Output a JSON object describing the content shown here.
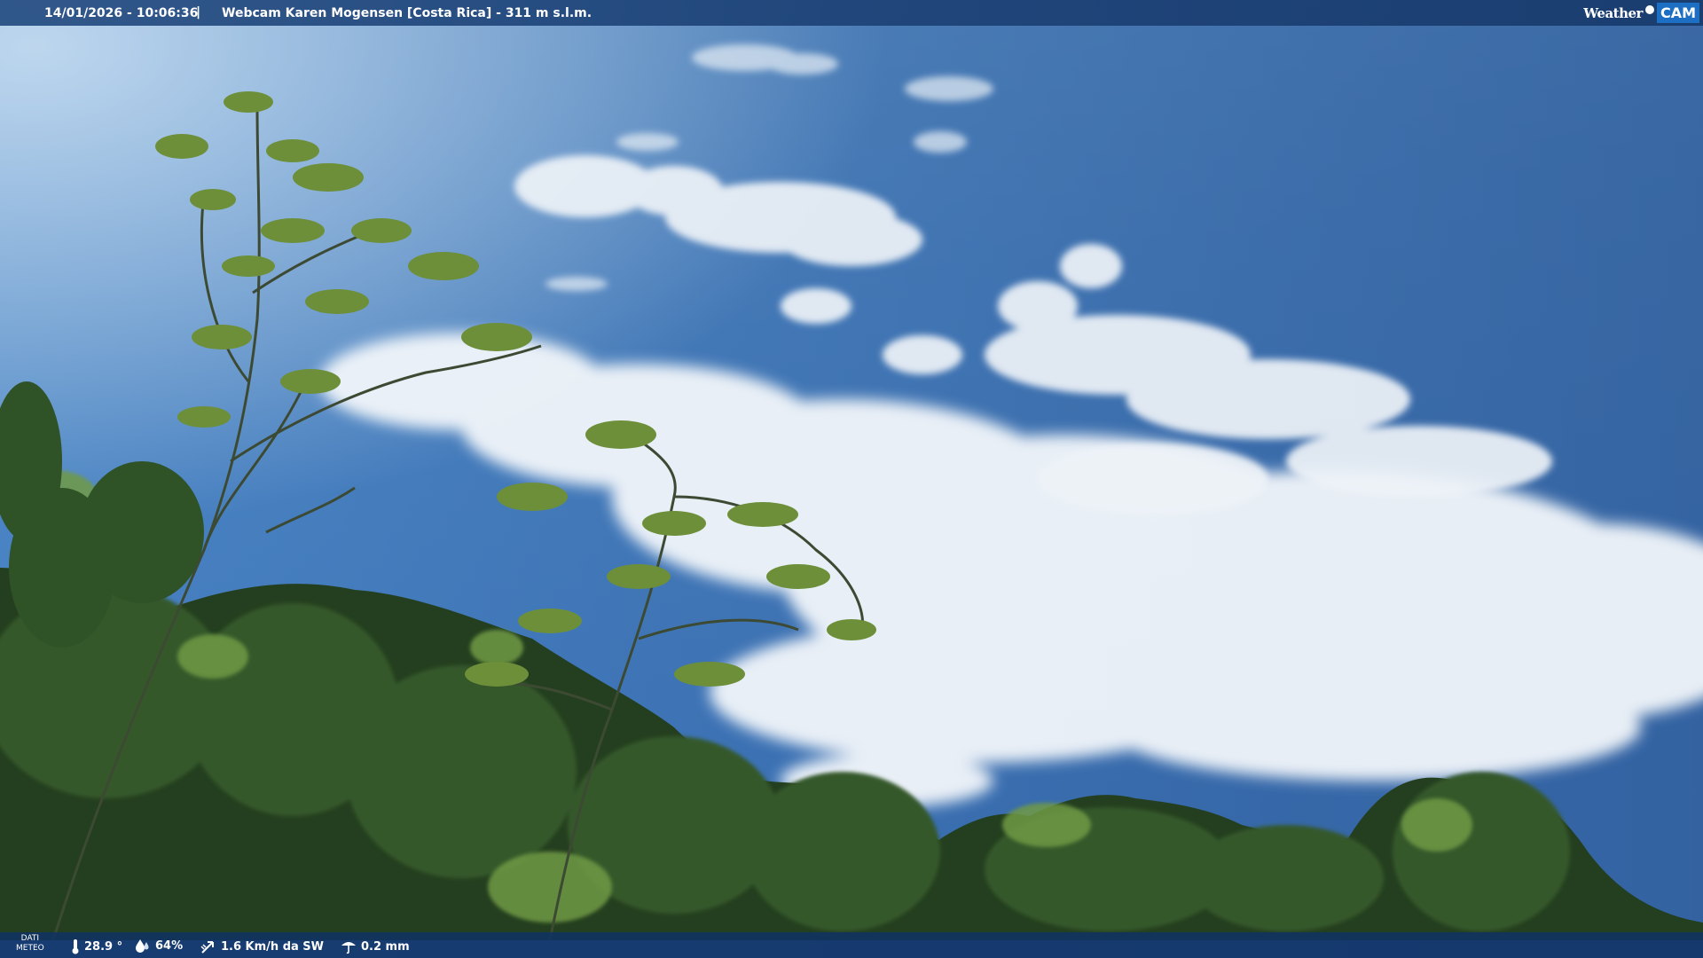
{
  "overlay": {
    "timestamp": "14/01/2026 - 10:06:36",
    "separator": "|",
    "camera_title": "Webcam Karen Mogensen [Costa Rica] - 311 m s.l.m.",
    "logo_weather": "Weather",
    "logo_cam": "CAM"
  },
  "meteo": {
    "label_line1": "DATI",
    "label_line2": "METEO",
    "temperature": "28.9 °",
    "humidity": "64%",
    "wind": "1.6 Km/h da SW",
    "rain": "0.2 mm",
    "icons": [
      "thermometer-icon",
      "humidity-icon",
      "wind-icon",
      "rain-gauge-icon"
    ]
  },
  "colors": {
    "sky_top": "#2f5f9e",
    "sky_mid": "#4b86c6",
    "cloud": "#eef3f8",
    "foliage_dark": "#1e3a1c",
    "foliage_light": "#6f9a45",
    "bar": "#12366a"
  }
}
